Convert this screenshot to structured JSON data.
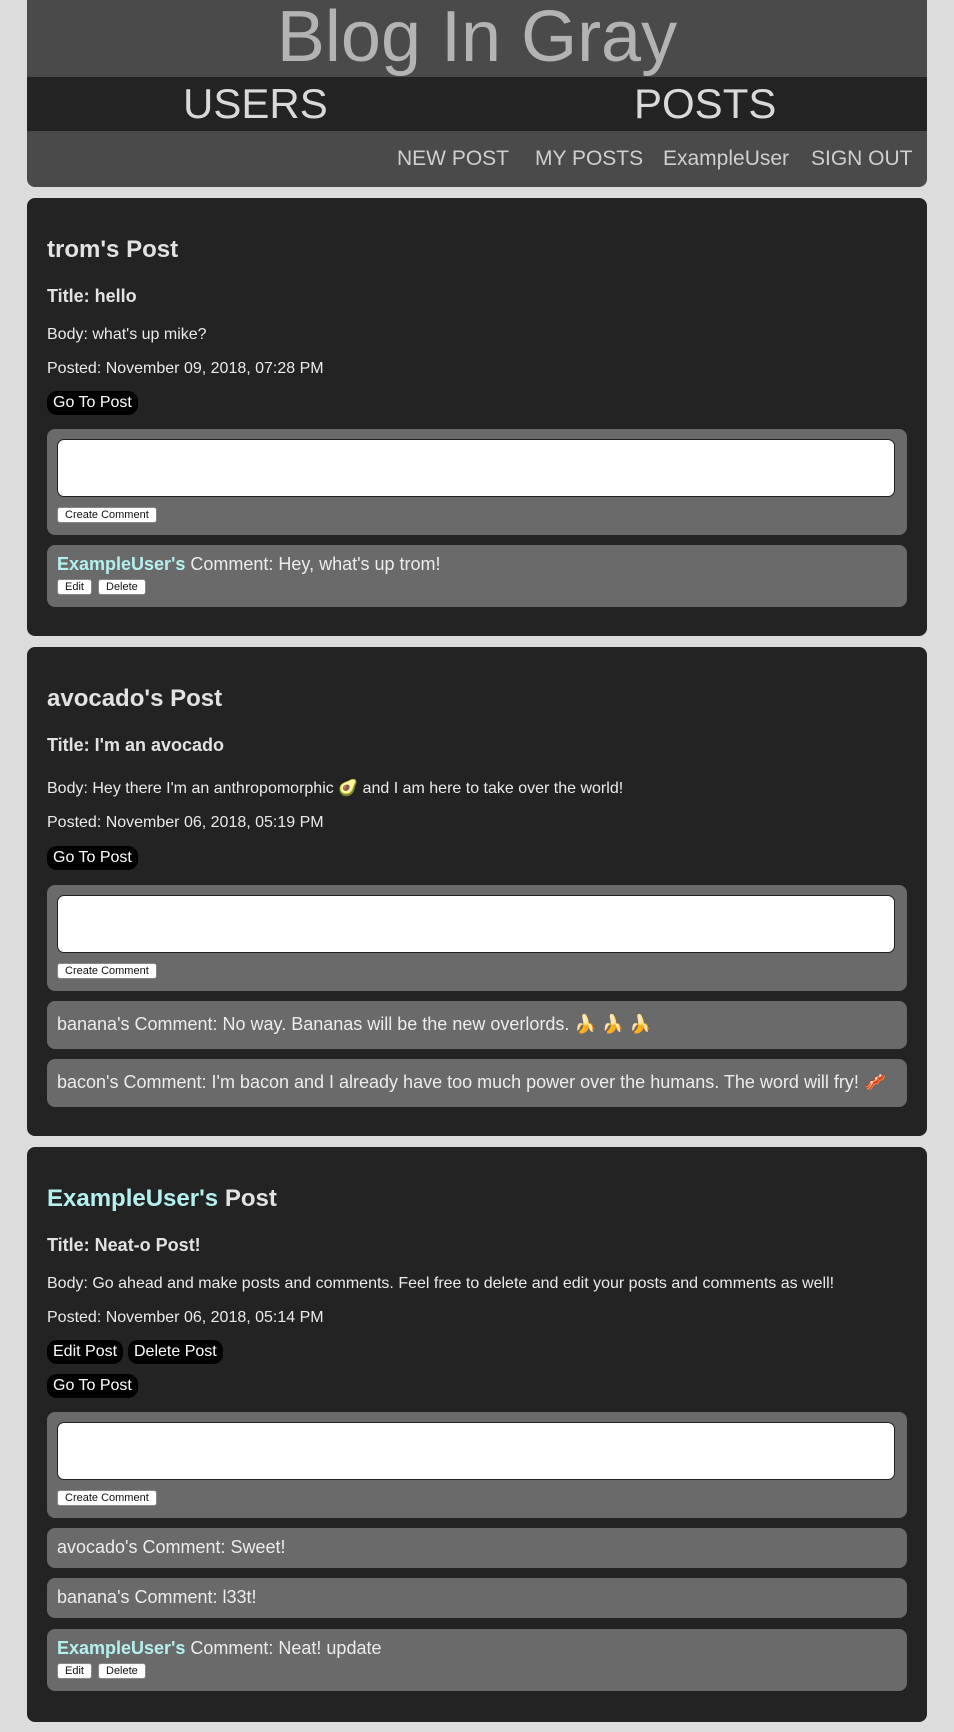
{
  "header": {
    "brand": "Blog In Gray",
    "nav": {
      "users": "USERS",
      "posts": "POSTS"
    },
    "subnav": {
      "new_post": "NEW POST",
      "my_posts": "MY POSTS",
      "username": "ExampleUser",
      "sign_out": "SIGN OUT"
    }
  },
  "posts": [
    {
      "author": "trom's",
      "author_suffix": "Post",
      "title": "Title: hello",
      "body": "Body: what's up mike?",
      "posted": "Posted: November 09, 2018, 07:28 PM",
      "go_label": "Go To Post",
      "create_comment_label": "Create Comment",
      "comments": [
        {
          "author": "ExampleUser's",
          "text": "Comment: Hey, what's up trom!",
          "edit": "Edit",
          "delete": "Delete"
        }
      ]
    },
    {
      "author": "avocado's",
      "author_suffix": "Post",
      "title": "Title: I'm an avocado",
      "body": "Body: Hey there I'm an anthropomorphic 🥑 and I am here to take over the world!",
      "posted": "Posted: November 06, 2018, 05:19 PM",
      "go_label": "Go To Post",
      "create_comment_label": "Create Comment",
      "comments": [
        {
          "text": "banana's Comment: No way. Bananas will be the new overlords. 🍌 🍌 🍌"
        },
        {
          "text": "bacon's Comment: I'm bacon and I already have too much power over the humans. The word will fry! 🥓"
        }
      ]
    },
    {
      "author": "ExampleUser's",
      "author_suffix": "Post",
      "title": "Title: Neat-o Post!",
      "body": "Body: Go ahead and make posts and comments.  Feel free to delete and edit your posts and comments as well!",
      "posted": "Posted: November 06, 2018, 05:14 PM",
      "edit_label": "Edit Post",
      "delete_label": "Delete Post",
      "go_label": "Go To Post",
      "create_comment_label": "Create Comment",
      "comments": [
        {
          "text": "avocado's Comment: Sweet!"
        },
        {
          "text": "banana's Comment: l33t!"
        },
        {
          "author": "ExampleUser's",
          "text": "Comment: Neat! update",
          "edit": "Edit",
          "delete": "Delete"
        }
      ]
    }
  ]
}
